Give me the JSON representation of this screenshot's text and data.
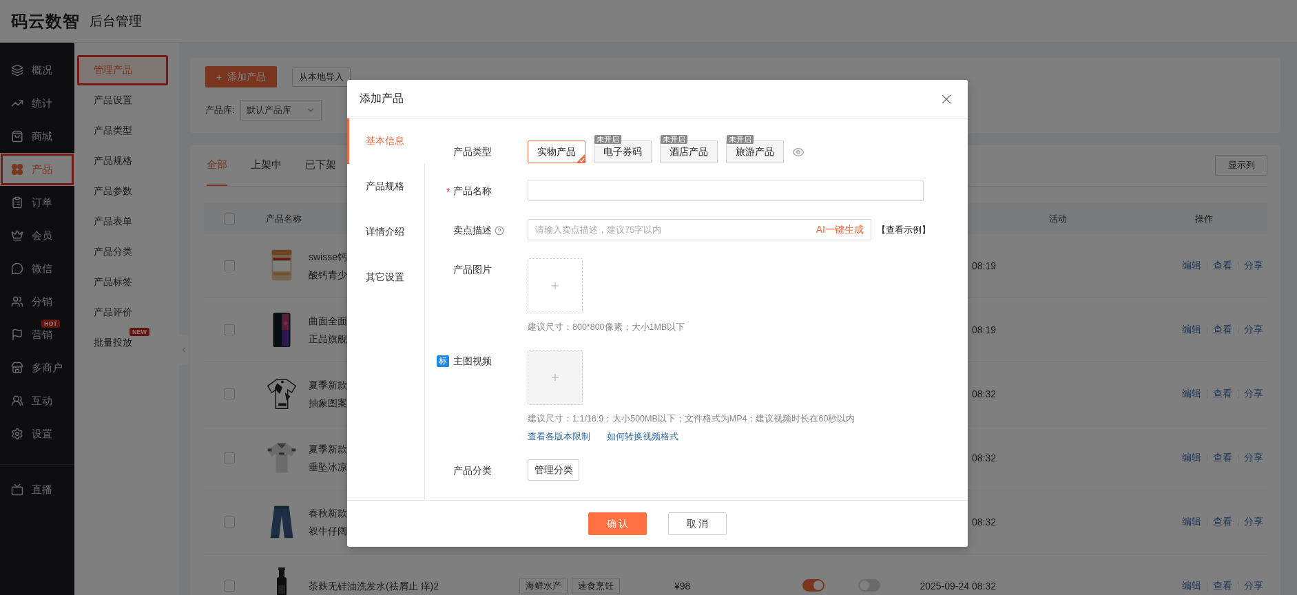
{
  "header": {
    "logo": "码云数智",
    "subtitle": "后台管理"
  },
  "sidebar": {
    "items": [
      {
        "label": "概况",
        "selected": false,
        "highlighted": false
      },
      {
        "label": "统计",
        "selected": false,
        "highlighted": false
      },
      {
        "label": "商城",
        "selected": false,
        "highlighted": false
      },
      {
        "label": "产品",
        "selected": true,
        "highlighted": true
      },
      {
        "label": "订单",
        "selected": false,
        "highlighted": false
      },
      {
        "label": "会员",
        "selected": false,
        "highlighted": false
      },
      {
        "label": "微信",
        "selected": false,
        "highlighted": false
      },
      {
        "label": "分销",
        "selected": false,
        "highlighted": false
      },
      {
        "label": "营销",
        "selected": false,
        "highlighted": false,
        "badge": "HOT"
      },
      {
        "label": "多商户",
        "selected": false,
        "highlighted": false
      },
      {
        "label": "互动",
        "selected": false,
        "highlighted": false
      },
      {
        "label": "设置",
        "selected": false,
        "highlighted": false
      }
    ],
    "bottom_items": [
      {
        "label": "直播",
        "selected": false
      }
    ]
  },
  "submenu": {
    "items": [
      {
        "label": "管理产品",
        "selected": true,
        "highlighted": true
      },
      {
        "label": "产品设置",
        "selected": false,
        "highlighted": false
      },
      {
        "label": "产品类型",
        "selected": false,
        "highlighted": false
      },
      {
        "label": "产品规格",
        "selected": false,
        "highlighted": false
      },
      {
        "label": "产品参数",
        "selected": false,
        "highlighted": false
      },
      {
        "label": "产品表单",
        "selected": false,
        "highlighted": false
      },
      {
        "label": "产品分类",
        "selected": false,
        "highlighted": false
      },
      {
        "label": "产品标签",
        "selected": false,
        "highlighted": false
      },
      {
        "label": "产品评价",
        "selected": false,
        "highlighted": false
      },
      {
        "label": "批量投放",
        "selected": false,
        "highlighted": false,
        "badge": "NEW"
      }
    ]
  },
  "toolbar": {
    "add_button": {
      "icon": "+",
      "label": "添加产品"
    },
    "import_button": "从本地导入"
  },
  "filters": [
    {
      "label": "产品库:",
      "value": "默认产品库"
    }
  ],
  "tabs": [
    {
      "label": "全部",
      "selected": true
    },
    {
      "label": "上架中",
      "selected": false
    },
    {
      "label": "已下架",
      "selected": false
    }
  ],
  "columns_button": "显示列",
  "table": {
    "all_checked": false,
    "columns": [
      "产品名称",
      "活动",
      "操作"
    ],
    "rows": [
      {
        "checked": false,
        "name_lines": [
          "swisse钙",
          "酸钙青少"
        ],
        "date": "08:19",
        "actions": [
          "编辑",
          "查看",
          "分享"
        ]
      },
      {
        "checked": false,
        "name_lines": [
          "曲面全面",
          "正品旗舰"
        ],
        "date": "08:19",
        "actions": [
          "编辑",
          "查看",
          "分享"
        ]
      },
      {
        "checked": false,
        "name_lines": [
          "夏季新款",
          "抽象图案"
        ],
        "date": "08:32",
        "actions": [
          "编辑",
          "查看",
          "分享"
        ]
      },
      {
        "checked": false,
        "name_lines": [
          "夏季新款",
          "垂坠冰凉"
        ],
        "date": "08:32",
        "actions": [
          "编辑",
          "查看",
          "分享"
        ]
      },
      {
        "checked": false,
        "name_lines": [
          "春秋新款",
          "衩牛仔阔"
        ],
        "date": "08:32",
        "actions": [
          "编辑",
          "查看",
          "分享"
        ]
      },
      {
        "checked": false,
        "name_lines": [
          "茶麸无硅油洗发水(祛屑止 痒)2"
        ],
        "tags": [
          "海鲜水产",
          "速食烹饪"
        ],
        "price": "¥98",
        "switch_1_on": true,
        "switch_2_on": false,
        "date": "2025-09-24 08:32",
        "actions": [
          "编辑",
          "查看",
          "分享"
        ]
      }
    ]
  },
  "modal": {
    "title": "添加产品",
    "nav": [
      {
        "label": "基本信息",
        "selected": true
      },
      {
        "label": "产品规格",
        "selected": false
      },
      {
        "label": "详情介绍",
        "selected": false
      },
      {
        "label": "其它设置",
        "selected": false
      }
    ],
    "fields": [
      {
        "kind": "options",
        "label": "产品类型",
        "options": [
          {
            "label": "实物产品",
            "selected": true
          },
          {
            "label": "电子券码",
            "selected": false,
            "badge": "未开启"
          },
          {
            "label": "酒店产品",
            "selected": false,
            "badge": "未开启"
          },
          {
            "label": "旅游产品",
            "selected": false,
            "badge": "未开启"
          }
        ]
      },
      {
        "kind": "input",
        "label": "产品名称",
        "required_mark": "*"
      },
      {
        "kind": "input",
        "label": "卖点描述",
        "help": true,
        "placeholder": "请输入卖点描述，建议75字以内",
        "suffix": "AI一键生成",
        "extra": "【查看示例】"
      },
      {
        "kind": "upload",
        "label": "产品图片",
        "hint": "建议尺寸：800*800像素；大小1MB以下"
      },
      {
        "kind": "upload",
        "label": "主图视频",
        "tag": "标",
        "shaded": true,
        "hint": "建议尺寸：1:1/16:9；大小500MB以下；文件格式为MP4；建议视频时长在60秒以内",
        "links": [
          "查看各版本限制",
          "如何转换视频格式"
        ]
      },
      {
        "kind": "button",
        "label": "产品分类",
        "button": "管理分类"
      }
    ],
    "buttons": [
      {
        "label": "确 认",
        "kind": "primary"
      },
      {
        "label": "取 消",
        "kind": "default"
      }
    ]
  }
}
